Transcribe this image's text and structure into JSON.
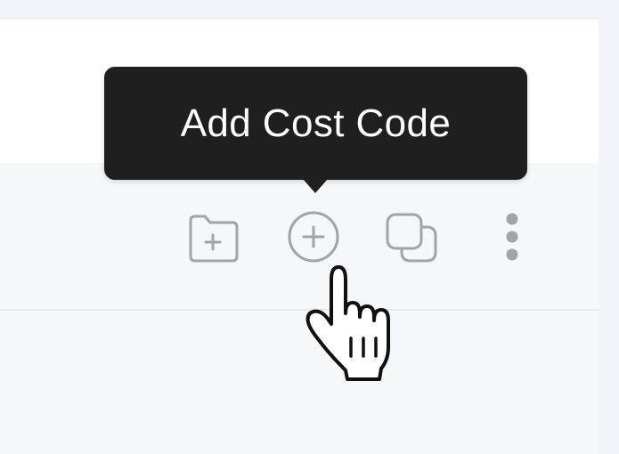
{
  "tooltip": {
    "text": "Add Cost Code"
  },
  "toolbar": {
    "buttons": [
      {
        "name": "add-folder",
        "icon": "folder-plus-icon"
      },
      {
        "name": "add-cost-code",
        "icon": "plus-circle-icon"
      },
      {
        "name": "duplicate",
        "icon": "copy-icon"
      },
      {
        "name": "more-options",
        "icon": "more-vertical-icon"
      }
    ]
  },
  "cursor": {
    "icon": "hand-pointer-icon"
  },
  "colors": {
    "icon_gray": "#a3a3a8",
    "tooltip_bg": "#1f1f1f",
    "tooltip_text": "#ffffff",
    "panel_bg": "#ffffff",
    "page_bg": "#f6f7f9"
  }
}
